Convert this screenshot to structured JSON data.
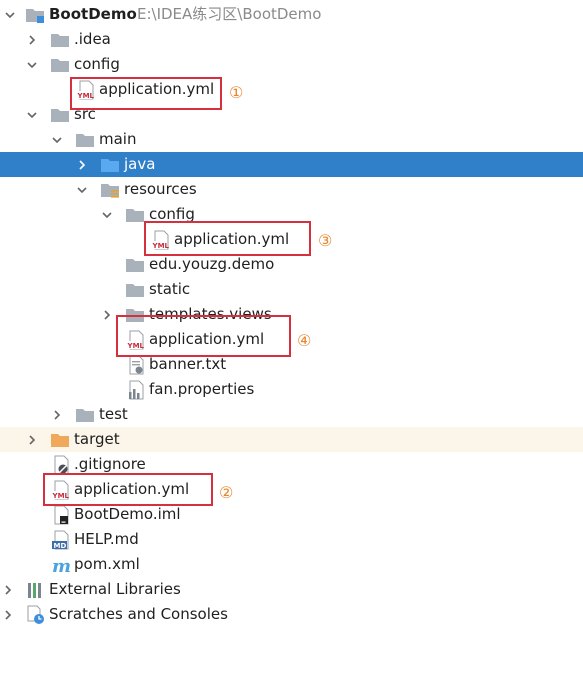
{
  "project_tree": {
    "root": {
      "label": "BootDemo",
      "path": "E:\\IDEA练习区\\BootDemo"
    },
    "items": [
      {
        "label": ".idea"
      },
      {
        "label": "config"
      },
      {
        "label": "application.yml"
      },
      {
        "label": "src"
      },
      {
        "label": "main"
      },
      {
        "label": "java"
      },
      {
        "label": "resources"
      },
      {
        "label": "config"
      },
      {
        "label": "application.yml"
      },
      {
        "label": "edu.youzg.demo"
      },
      {
        "label": "static"
      },
      {
        "label": "templates.views"
      },
      {
        "label": "application.yml"
      },
      {
        "label": "banner.txt"
      },
      {
        "label": "fan.properties"
      },
      {
        "label": "test"
      },
      {
        "label": "target"
      },
      {
        "label": ".gitignore"
      },
      {
        "label": "application.yml"
      },
      {
        "label": "BootDemo.iml"
      },
      {
        "label": "HELP.md"
      },
      {
        "label": "pom.xml"
      },
      {
        "label": "External Libraries"
      },
      {
        "label": "Scratches and Consoles"
      }
    ]
  },
  "annotations": {
    "n1": "①",
    "n2": "②",
    "n3": "③",
    "n4": "④"
  },
  "colors": {
    "selection": "#2f80c8",
    "excluded_row": "#fbf6e9",
    "highlight_box": "#d6303f",
    "annotation": "#e8862e",
    "folder": "#a9b1ba",
    "source_folder": "#3d8fdc",
    "excluded_folder": "#f0a95a"
  }
}
